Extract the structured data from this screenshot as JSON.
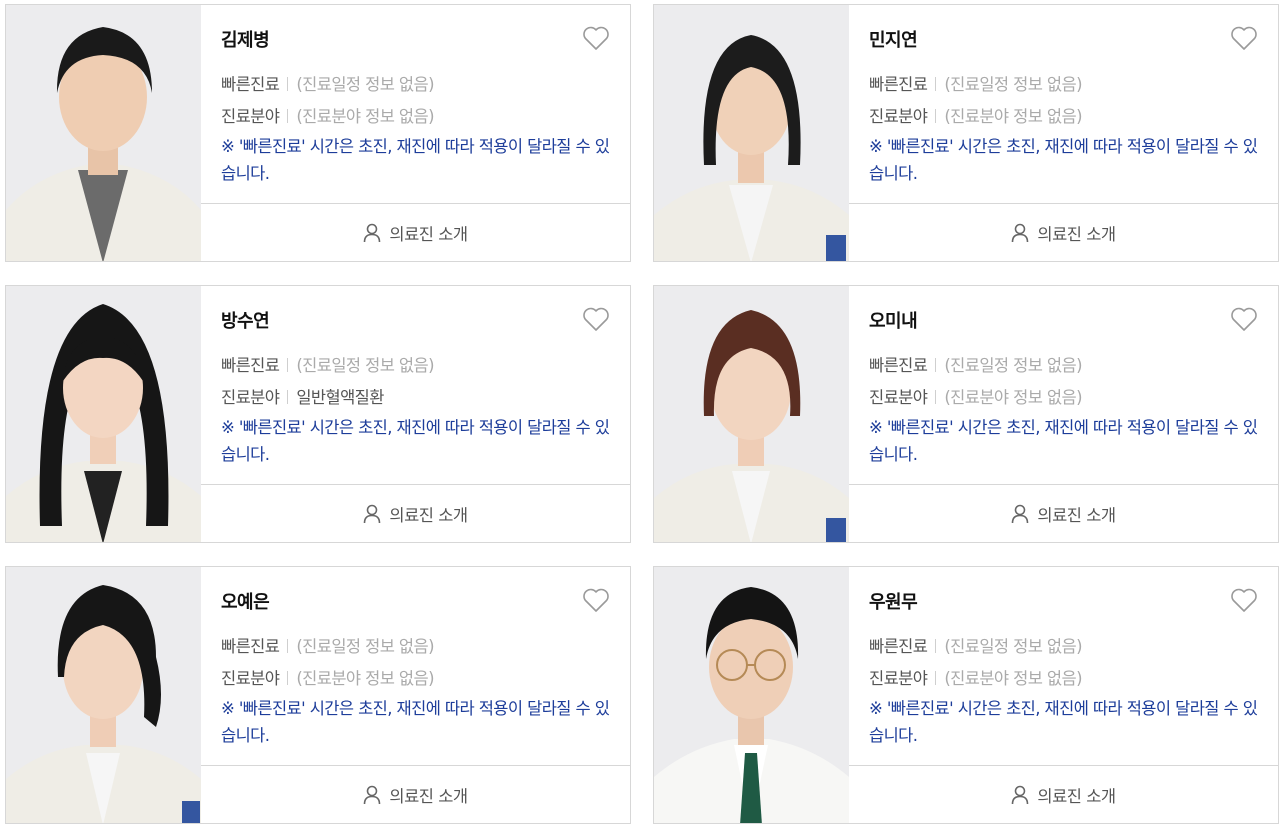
{
  "labels": {
    "fast_care": "빠른진료",
    "field": "진료분야",
    "note": "※ '빠른진료' 시간은 초진, 재진에 따라 적용이 달라질 수 있습니다.",
    "staff_intro": "의료진 소개"
  },
  "icons": {
    "favorite": "heart-outline-icon",
    "staff": "person-icon"
  },
  "colors": {
    "note_text": "#1d3d9a",
    "placeholder_text": "#aaaaaa",
    "label_text": "#555555",
    "border": "#d7d7d7"
  },
  "doctors": [
    {
      "name": "김제병",
      "schedule": "(진료일정 정보 없음)",
      "field": "(진료분야 정보 없음)"
    },
    {
      "name": "민지연",
      "schedule": "(진료일정 정보 없음)",
      "field": "(진료분야 정보 없음)"
    },
    {
      "name": "방수연",
      "schedule": "(진료일정 정보 없음)",
      "field": "일반혈액질환"
    },
    {
      "name": "오미내",
      "schedule": "(진료일정 정보 없음)",
      "field": "(진료분야 정보 없음)"
    },
    {
      "name": "오예은",
      "schedule": "(진료일정 정보 없음)",
      "field": "(진료분야 정보 없음)"
    },
    {
      "name": "우원무",
      "schedule": "(진료일정 정보 없음)",
      "field": "(진료분야 정보 없음)"
    }
  ]
}
